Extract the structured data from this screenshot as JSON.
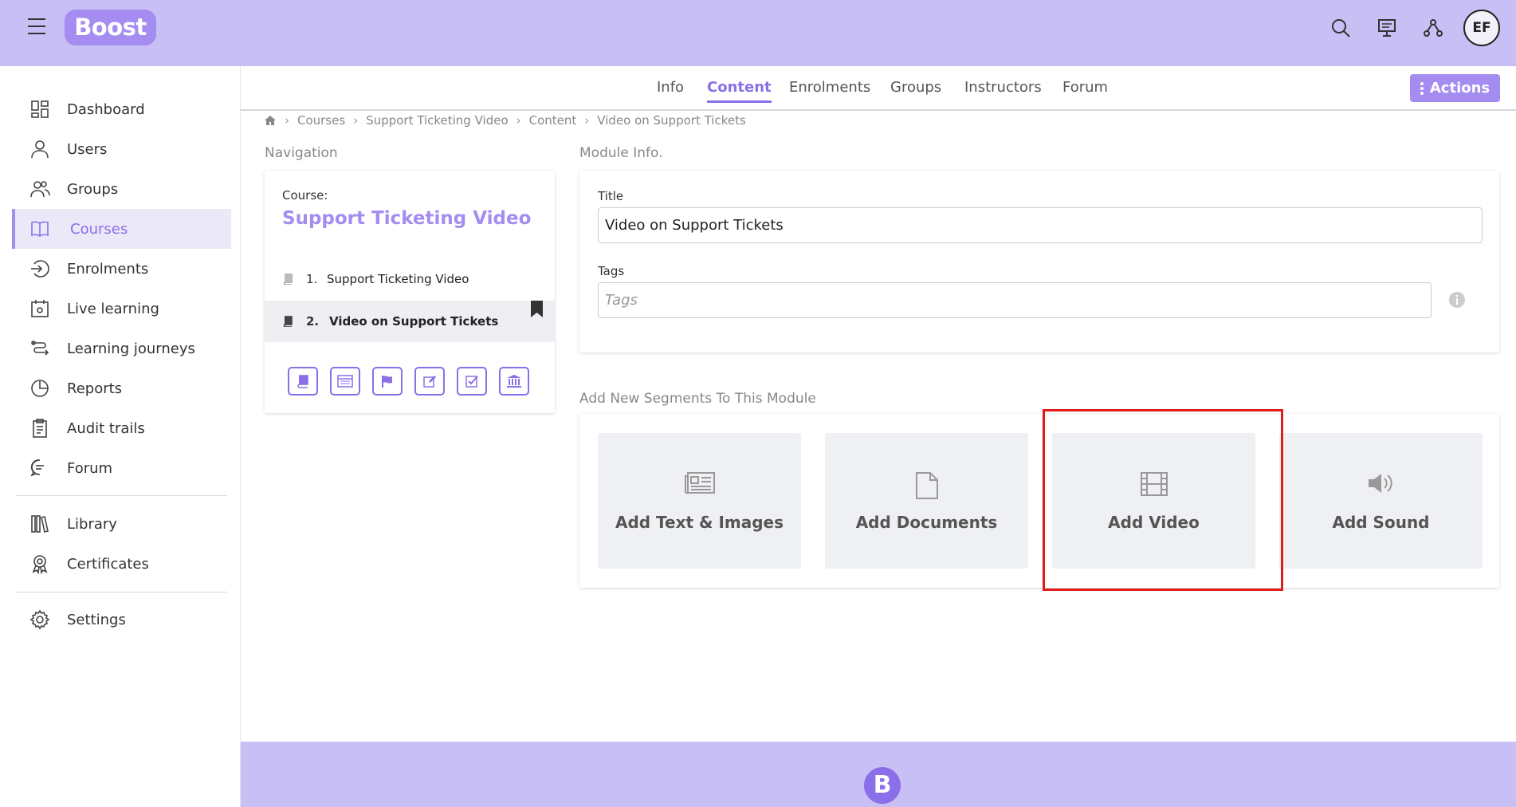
{
  "brand": {
    "logo_text": "Boost",
    "footer_logo_text": "B",
    "accent": "#a48cf0",
    "highlight": "#e01b1b"
  },
  "header": {
    "user_initials": "EF",
    "icons": [
      "menu-icon",
      "search-icon",
      "presentation-icon",
      "network-icon"
    ]
  },
  "sidebar": {
    "items": [
      {
        "label": "Dashboard",
        "icon": "dashboard-icon"
      },
      {
        "label": "Users",
        "icon": "user-icon"
      },
      {
        "label": "Groups",
        "icon": "groups-icon"
      },
      {
        "label": "Courses",
        "icon": "book-open-icon",
        "active": true
      },
      {
        "label": "Enrolments",
        "icon": "enter-icon"
      },
      {
        "label": "Live learning",
        "icon": "calendar-icon"
      },
      {
        "label": "Learning journeys",
        "icon": "route-icon"
      },
      {
        "label": "Reports",
        "icon": "pie-chart-icon"
      },
      {
        "label": "Audit trails",
        "icon": "clipboard-icon"
      },
      {
        "label": "Forum",
        "icon": "chat-icon"
      },
      {
        "label": "Library",
        "icon": "library-icon"
      },
      {
        "label": "Certificates",
        "icon": "award-icon"
      },
      {
        "label": "Settings",
        "icon": "gear-icon"
      }
    ]
  },
  "tabs": [
    {
      "label": "Info"
    },
    {
      "label": "Content",
      "active": true
    },
    {
      "label": "Enrolments"
    },
    {
      "label": "Groups"
    },
    {
      "label": "Instructors"
    },
    {
      "label": "Forum"
    }
  ],
  "actions_label": "Actions",
  "breadcrumb": [
    "Courses",
    "Support Ticketing Video",
    "Content",
    "Video on Support Tickets"
  ],
  "navigation": {
    "section_title": "Navigation",
    "course_label": "Course:",
    "course_name": "Support Ticketing Video",
    "modules": [
      {
        "num": "1.",
        "title": "Support Ticketing Video"
      },
      {
        "num": "2.",
        "title": "Video on Support Tickets",
        "active": true
      }
    ],
    "tools": [
      "book-icon",
      "web-page-icon",
      "flag-icon",
      "edit-icon",
      "checkbox-icon",
      "institution-icon"
    ]
  },
  "module_info": {
    "section_title": "Module Info.",
    "title_label": "Title",
    "title_value": "Video on Support Tickets",
    "tags_label": "Tags",
    "tags_placeholder": "Tags"
  },
  "segments": {
    "section_title": "Add New Segments To This Module",
    "items": [
      {
        "label": "Add Text & Images",
        "icon": "newspaper-icon"
      },
      {
        "label": "Add Documents",
        "icon": "document-icon"
      },
      {
        "label": "Add Video",
        "icon": "film-icon"
      },
      {
        "label": "Add Sound",
        "icon": "volume-icon"
      }
    ]
  }
}
